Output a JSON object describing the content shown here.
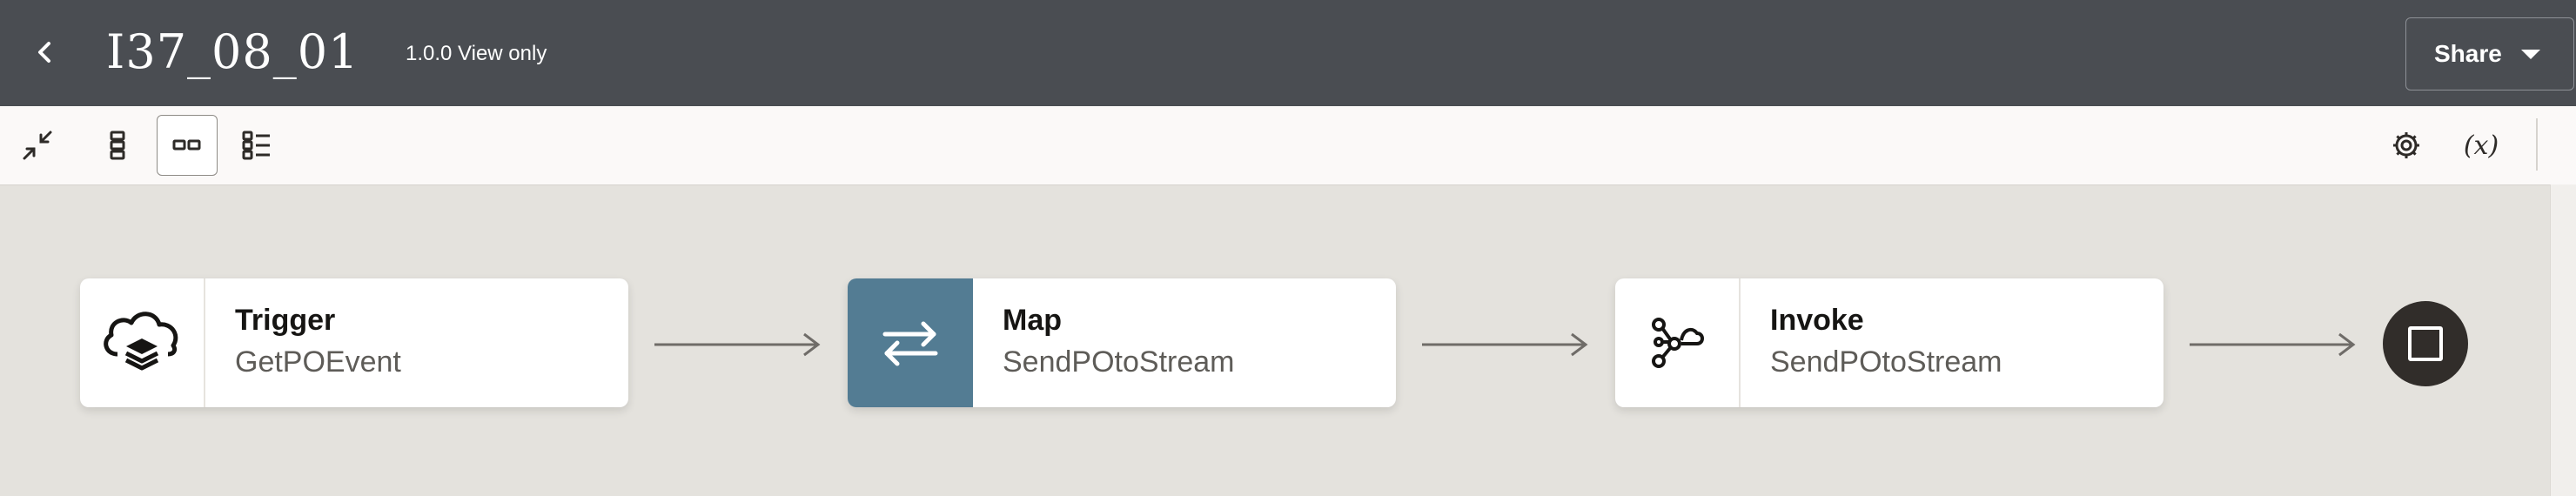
{
  "header": {
    "title": "I37_08_01",
    "version_label": "1.0.0 View only",
    "share_label": "Share",
    "icons": {
      "back": "chevron-left-icon",
      "share_menu": "chevron-down-icon"
    }
  },
  "toolbar": {
    "left_tools": [
      {
        "name": "collapse-icon"
      },
      {
        "name": "vertical-layout-icon"
      },
      {
        "name": "horizontal-layout-icon",
        "active": true
      },
      {
        "name": "pseudo-layout-icon"
      }
    ],
    "right_tools": [
      {
        "name": "gear-icon"
      },
      {
        "name": "variables-icon",
        "label": "(x)"
      }
    ]
  },
  "flow": {
    "nodes": [
      {
        "type": "Trigger",
        "name": "GetPOEvent",
        "icon": "cloud-stack-icon"
      },
      {
        "type": "Map",
        "name": "SendPOtoStream",
        "icon": "swap-arrows-icon",
        "accent": "#537c93"
      },
      {
        "type": "Invoke",
        "name": "SendPOtoStream",
        "icon": "stream-network-icon"
      }
    ],
    "end_icon": "stop-icon"
  },
  "colors": {
    "header_bg": "#4a4d52",
    "toolbar_bg": "#fbf9f8",
    "canvas_bg": "#e4e2dd",
    "map_accent": "#537c93",
    "end_node": "#312d2a"
  }
}
